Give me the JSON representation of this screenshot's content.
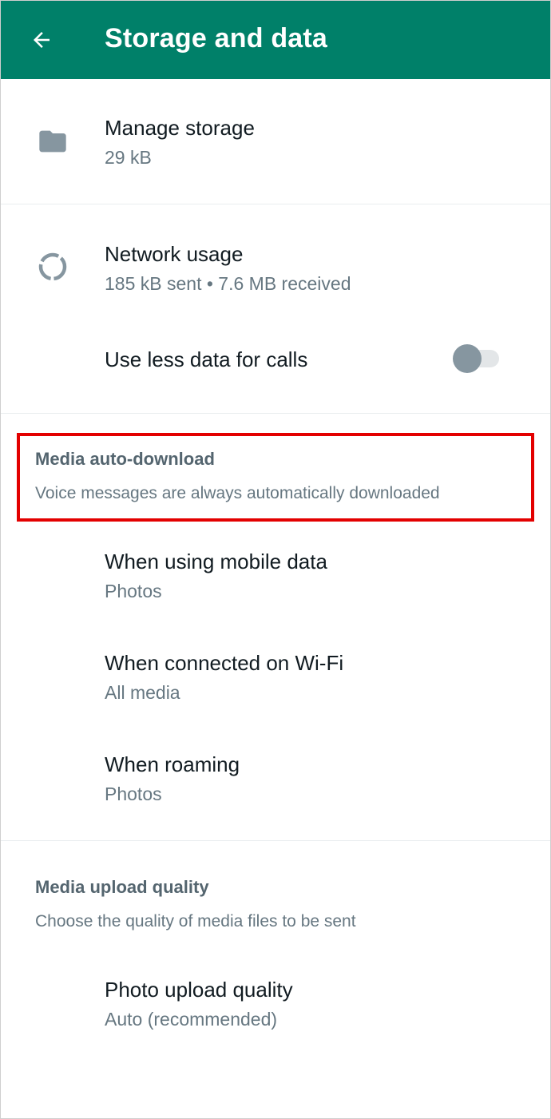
{
  "header": {
    "title": "Storage and data",
    "back_icon": "arrow-left-icon",
    "background": "#008069"
  },
  "storage": {
    "icon": "folder-icon",
    "label": "Manage storage",
    "value": "29 kB"
  },
  "network": {
    "icon": "data-usage-icon",
    "label": "Network usage",
    "value": "185 kB sent • 7.6 MB received"
  },
  "calls": {
    "label": "Use less data for calls",
    "toggle_on": false
  },
  "auto_download": {
    "title": "Media auto-download",
    "subtitle": "Voice messages are always automatically downloaded",
    "items": [
      {
        "label": "When using mobile data",
        "value": "Photos"
      },
      {
        "label": "When connected on Wi-Fi",
        "value": "All media"
      },
      {
        "label": "When roaming",
        "value": "Photos"
      }
    ]
  },
  "upload_quality": {
    "title": "Media upload quality",
    "subtitle": "Choose the quality of media files to be sent",
    "items": [
      {
        "label": "Photo upload quality",
        "value": "Auto (recommended)"
      }
    ]
  },
  "highlight_color": "#e30000"
}
